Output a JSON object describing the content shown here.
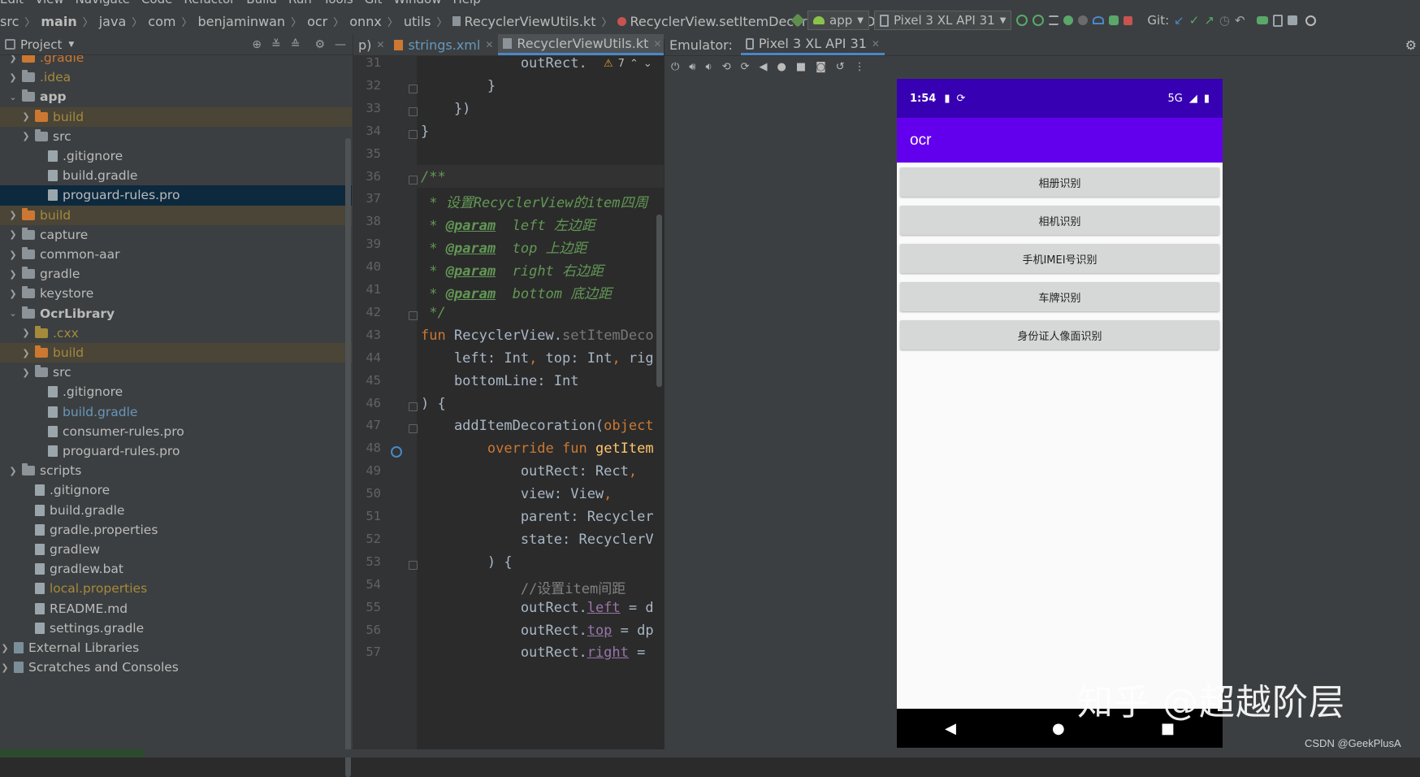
{
  "menu": [
    "Edit",
    "View",
    "Navigate",
    "Code",
    "Refactor",
    "Build",
    "Run",
    "Tools",
    "Git",
    "Window",
    "Help"
  ],
  "breadcrumb": [
    "src",
    "main",
    "java",
    "com",
    "benjaminwan",
    "ocr",
    "onnx",
    "utils",
    "RecyclerViewUtils.kt",
    "RecyclerView.setItemDecorationAndDrawBottom"
  ],
  "run_toolbar": {
    "config": "app",
    "device": "Pixel 3 XL API 31",
    "git_label": "Git:"
  },
  "project": {
    "title": "Project",
    "tree": [
      {
        "label": ".gradle",
        "depth": 1,
        "arrow": ">",
        "type": "folder-orange",
        "color": "orange"
      },
      {
        "label": ".idea",
        "depth": 1,
        "arrow": ">",
        "type": "folder-gray",
        "color": "olive"
      },
      {
        "label": "app",
        "depth": 1,
        "arrow": "v",
        "type": "folder-gray",
        "color": "bold"
      },
      {
        "label": "build",
        "depth": 2,
        "arrow": ">",
        "type": "folder-orange",
        "color": "olive",
        "highlight": true
      },
      {
        "label": "src",
        "depth": 2,
        "arrow": ">",
        "type": "folder-gray",
        "color": ""
      },
      {
        "label": ".gitignore",
        "depth": 3,
        "arrow": "",
        "type": "file",
        "color": ""
      },
      {
        "label": "build.gradle",
        "depth": 3,
        "arrow": "",
        "type": "file",
        "color": ""
      },
      {
        "label": "proguard-rules.pro",
        "depth": 3,
        "arrow": "",
        "type": "file",
        "color": "",
        "selected": true
      },
      {
        "label": "build",
        "depth": 1,
        "arrow": ">",
        "type": "folder-orange",
        "color": "olive",
        "highlight": true
      },
      {
        "label": "capture",
        "depth": 1,
        "arrow": ">",
        "type": "folder-gray",
        "color": ""
      },
      {
        "label": "common-aar",
        "depth": 1,
        "arrow": ">",
        "type": "folder-gray",
        "color": ""
      },
      {
        "label": "gradle",
        "depth": 1,
        "arrow": ">",
        "type": "folder-gray",
        "color": ""
      },
      {
        "label": "keystore",
        "depth": 1,
        "arrow": ">",
        "type": "folder-gray",
        "color": ""
      },
      {
        "label": "OcrLibrary",
        "depth": 1,
        "arrow": "v",
        "type": "folder-gray",
        "color": "bold"
      },
      {
        "label": ".cxx",
        "depth": 2,
        "arrow": ">",
        "type": "folder-yellow",
        "color": "olive"
      },
      {
        "label": "build",
        "depth": 2,
        "arrow": ">",
        "type": "folder-orange",
        "color": "olive",
        "highlight": true
      },
      {
        "label": "src",
        "depth": 2,
        "arrow": ">",
        "type": "folder-gray",
        "color": ""
      },
      {
        "label": ".gitignore",
        "depth": 3,
        "arrow": "",
        "type": "file",
        "color": ""
      },
      {
        "label": "build.gradle",
        "depth": 3,
        "arrow": "",
        "type": "file",
        "color": "blue"
      },
      {
        "label": "consumer-rules.pro",
        "depth": 3,
        "arrow": "",
        "type": "file",
        "color": ""
      },
      {
        "label": "proguard-rules.pro",
        "depth": 3,
        "arrow": "",
        "type": "file",
        "color": ""
      },
      {
        "label": "scripts",
        "depth": 1,
        "arrow": ">",
        "type": "folder-gray",
        "color": ""
      },
      {
        "label": ".gitignore",
        "depth": 2,
        "arrow": "",
        "type": "file",
        "color": ""
      },
      {
        "label": "build.gradle",
        "depth": 2,
        "arrow": "",
        "type": "file",
        "color": ""
      },
      {
        "label": "gradle.properties",
        "depth": 2,
        "arrow": "",
        "type": "file",
        "color": ""
      },
      {
        "label": "gradlew",
        "depth": 2,
        "arrow": "",
        "type": "file",
        "color": ""
      },
      {
        "label": "gradlew.bat",
        "depth": 2,
        "arrow": "",
        "type": "file",
        "color": ""
      },
      {
        "label": "local.properties",
        "depth": 2,
        "arrow": "",
        "type": "file",
        "color": "olive"
      },
      {
        "label": "README.md",
        "depth": 2,
        "arrow": "",
        "type": "file",
        "color": ""
      },
      {
        "label": "settings.gradle",
        "depth": 2,
        "arrow": "",
        "type": "file",
        "color": ""
      },
      {
        "label": "External Libraries",
        "depth": 0,
        "arrow": ">",
        "type": "lib",
        "color": ""
      },
      {
        "label": "Scratches and Consoles",
        "depth": 0,
        "arrow": ">",
        "type": "lib",
        "color": ""
      }
    ]
  },
  "editor": {
    "tabs": [
      {
        "label": "p)",
        "active": false
      },
      {
        "label": "strings.xml",
        "active": false
      },
      {
        "label": "RecyclerViewUtils.kt",
        "active": true
      }
    ],
    "warning_count": "7",
    "lines": [
      {
        "n": "31",
        "html": "            outRect."
      },
      {
        "n": "32",
        "html": "        }"
      },
      {
        "n": "33",
        "html": "    })"
      },
      {
        "n": "34",
        "html": "}"
      },
      {
        "n": "35",
        "html": ""
      },
      {
        "n": "36",
        "html": "<span class='cm'>/**</span>"
      },
      {
        "n": "37",
        "html": "<span class='cm'> * 设置RecyclerView的item四周</span>"
      },
      {
        "n": "38",
        "html": "<span class='cm'> * </span><span class='tag'>@param</span><span class='cm'>  left 左边距</span>"
      },
      {
        "n": "39",
        "html": "<span class='cm'> * </span><span class='tag'>@param</span><span class='cm'>  top 上边距</span>"
      },
      {
        "n": "40",
        "html": "<span class='cm'> * </span><span class='tag'>@param</span><span class='cm'>  right 右边距</span>"
      },
      {
        "n": "41",
        "html": "<span class='cm'> * </span><span class='tag'>@param</span><span class='cm'>  bottom 底边距</span>"
      },
      {
        "n": "42",
        "html": "<span class='cm'> */</span>"
      },
      {
        "n": "43",
        "html": "<span class='kw'>fun</span> RecyclerView.<span class='gray'>setItemDeco</span>"
      },
      {
        "n": "44",
        "html": "    left: Int<span class='kw'>,</span> top: Int<span class='kw'>,</span> rig"
      },
      {
        "n": "45",
        "html": "    bottomLine: Int"
      },
      {
        "n": "46",
        "html": ") {"
      },
      {
        "n": "47",
        "html": "    addItemDecoration(<span class='kw'>object</span>"
      },
      {
        "n": "48",
        "html": "        <span class='kw'>override fun</span> <span class='fn'>getItem</span>"
      },
      {
        "n": "49",
        "html": "            outRect: Rect<span class='kw'>,</span>"
      },
      {
        "n": "50",
        "html": "            view: View<span class='kw'>,</span>"
      },
      {
        "n": "51",
        "html": "            parent: Recycler"
      },
      {
        "n": "52",
        "html": "            state: RecyclerV"
      },
      {
        "n": "53",
        "html": "        ) {"
      },
      {
        "n": "54",
        "html": "            <span class='lc'>//设置item间距</span>"
      },
      {
        "n": "55",
        "html": "            outRect.<span class='prop'>left</span> = d"
      },
      {
        "n": "56",
        "html": "            outRect.<span class='prop'>top</span> = dp"
      },
      {
        "n": "57",
        "html": "            outRect.<span class='prop'>right</span> ="
      }
    ]
  },
  "emulator": {
    "label": "Emulator:",
    "device_tab": "Pixel 3 XL API 31",
    "status_time": "1:54",
    "status_network": "5G",
    "app_title": "ocr",
    "buttons": [
      "相册识别",
      "相机识别",
      "手机IMEI号识别",
      "车牌识别",
      "身份证人像面识别"
    ]
  },
  "watermark": "知乎 @超越阶层",
  "csdn_credit": "CSDN @GeekPlusA"
}
